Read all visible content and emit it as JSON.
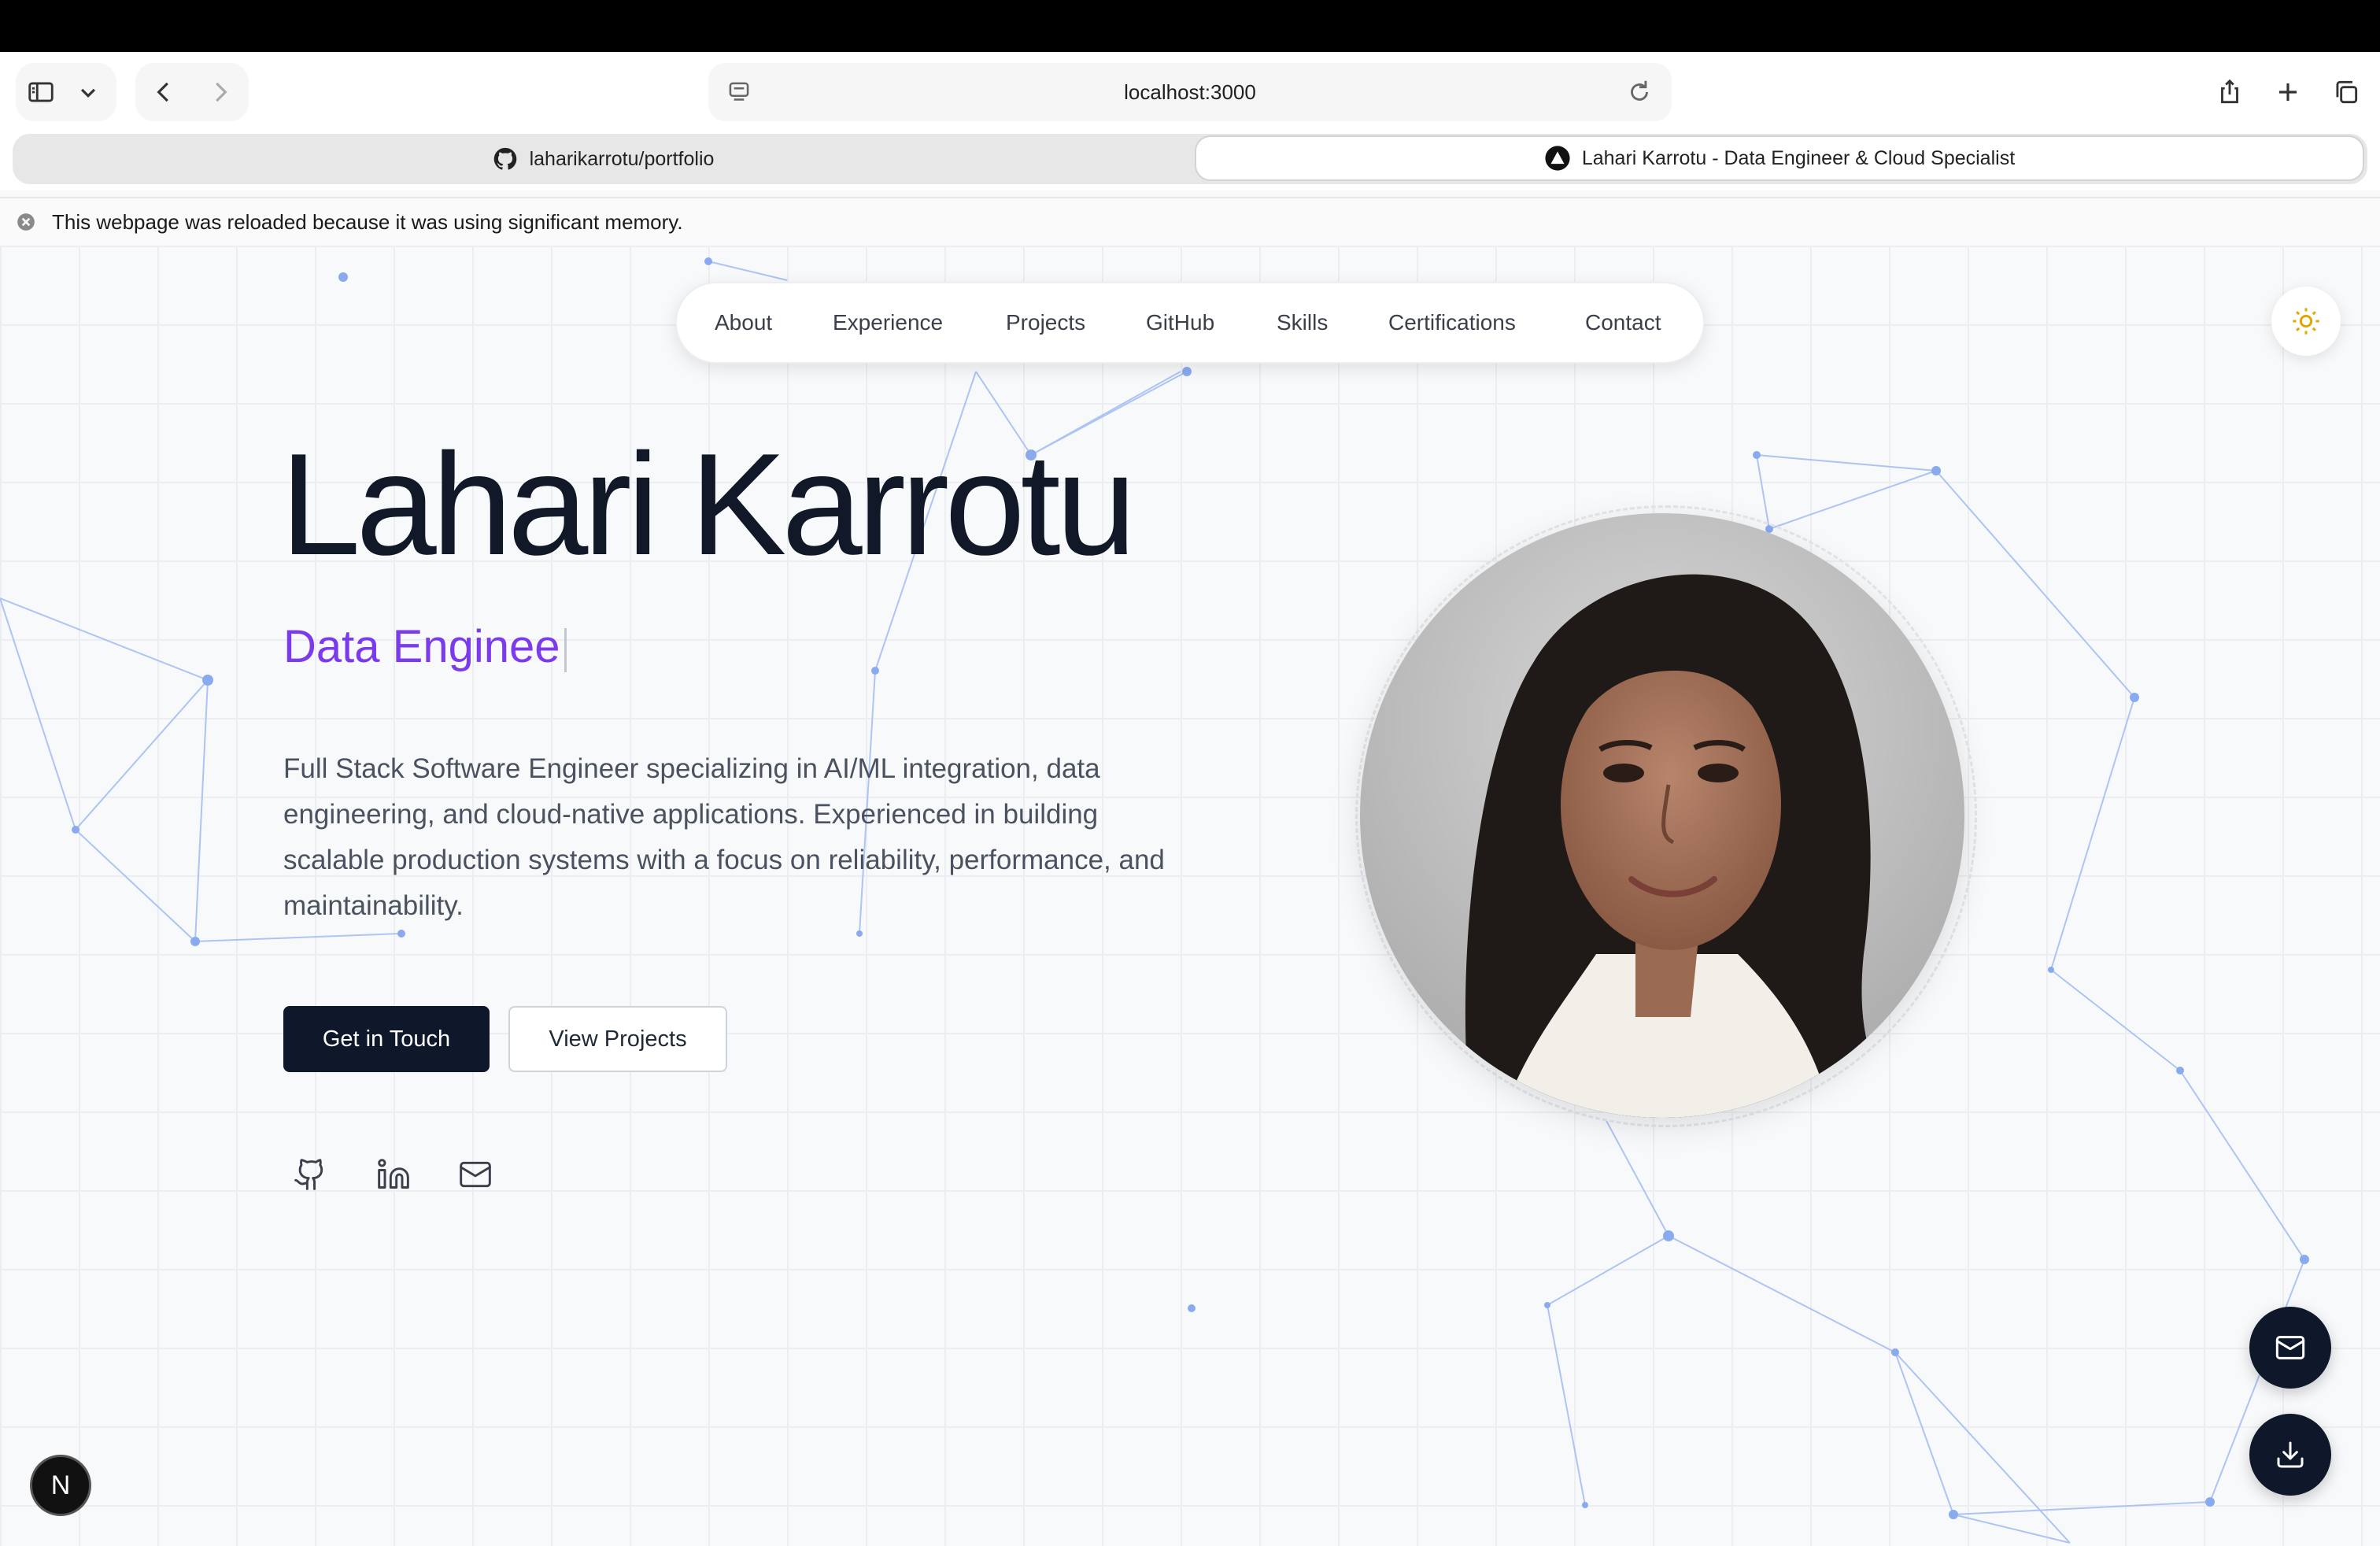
{
  "browser": {
    "url": "localhost:3000",
    "tabs": [
      {
        "label": "laharikarrotu/portfolio",
        "icon": "github-icon",
        "active": false
      },
      {
        "label": "Lahari Karrotu - Data Engineer & Cloud Specialist",
        "icon": "vercel-triangle-icon",
        "active": true
      }
    ],
    "infobar_message": "This webpage was reloaded because it was using significant memory."
  },
  "nav": {
    "items": [
      "About",
      "Experience",
      "Projects",
      "GitHub",
      "Skills",
      "Certifications",
      "Contact"
    ]
  },
  "hero": {
    "name": "Lahari Karrotu",
    "role_typed": "Data Enginee",
    "description": "Full Stack Software Engineer specializing in AI/ML integration, data engineering, and cloud-native applications. Experienced in building scalable production systems with a focus on reliability, performance, and maintainability.",
    "primary_button": "Get in Touch",
    "secondary_button": "View Projects",
    "social_icons": [
      "github-icon",
      "linkedin-icon",
      "mail-icon"
    ]
  },
  "floating": {
    "icons": [
      "mail-icon",
      "download-icon"
    ],
    "badge_letter": "N"
  },
  "colors": {
    "accent": "#7c3aed",
    "dark": "#0f172a",
    "network": "#8fb0f0"
  }
}
